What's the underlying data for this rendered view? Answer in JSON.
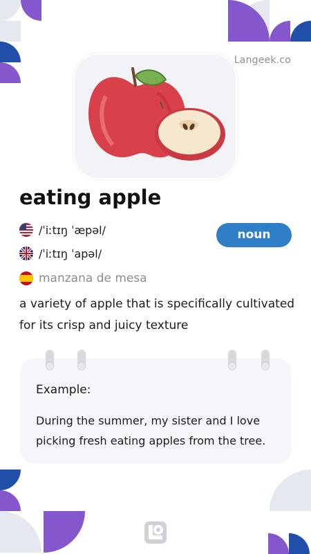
{
  "brand": {
    "name": "Langeek.co"
  },
  "image": {
    "alt": "eating apple illustration",
    "icon": "apple-illustration"
  },
  "entry": {
    "word": "eating apple",
    "part_of_speech": "noun",
    "pronunciations": [
      {
        "region": "us-flag-icon",
        "ipa": "/ˈiːtɪŋ ˈæpəl/"
      },
      {
        "region": "uk-flag-icon",
        "ipa": "/ˈiːtɪŋ ˈapəl/"
      }
    ],
    "translation": {
      "language": "spain-flag-icon",
      "text": "manzana de mesa"
    },
    "definition": "a variety of apple that is specifically cultivated for its crisp and juicy texture"
  },
  "example": {
    "label": "Example:",
    "text": "During the summer, my sister and I love picking fresh eating apples from the tree."
  },
  "colors": {
    "accent_purple": "#8557cc",
    "accent_blue": "#1f4fa8",
    "light_gray": "#e6e8ef",
    "pos_badge": "#2f7fc8"
  }
}
